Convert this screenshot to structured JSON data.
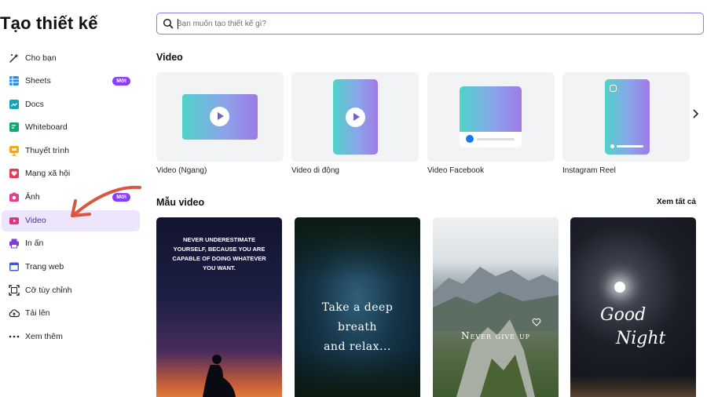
{
  "sidebar": {
    "title": "Tạo thiết kế",
    "items": [
      {
        "label": "Cho bạn",
        "icon": "sparkle-icon"
      },
      {
        "label": "Sheets",
        "icon": "sheets-icon",
        "badge": "Mới"
      },
      {
        "label": "Docs",
        "icon": "docs-icon"
      },
      {
        "label": "Whiteboard",
        "icon": "whiteboard-icon"
      },
      {
        "label": "Thuyết trình",
        "icon": "presentation-icon"
      },
      {
        "label": "Mạng xã hội",
        "icon": "heart-icon"
      },
      {
        "label": "Ảnh",
        "icon": "camera-icon",
        "badge": "Mới"
      },
      {
        "label": "Video",
        "icon": "video-icon",
        "active": true
      },
      {
        "label": "In ấn",
        "icon": "printer-icon"
      },
      {
        "label": "Trang web",
        "icon": "website-icon"
      },
      {
        "label": "Cỡ tùy chỉnh",
        "icon": "custom-size-icon"
      },
      {
        "label": "Tải lên",
        "icon": "cloud-upload-icon"
      },
      {
        "label": "Xem thêm",
        "icon": "more-icon"
      }
    ]
  },
  "search": {
    "placeholder": "Bạn muốn tạo thiết kế gì?"
  },
  "video_section": {
    "title": "Video",
    "cards": [
      {
        "label": "Video (Ngang)"
      },
      {
        "label": "Video di động"
      },
      {
        "label": "Video Facebook"
      },
      {
        "label": "Instagram Reel"
      }
    ]
  },
  "templates_section": {
    "title": "Mẫu video",
    "see_all": "Xem tất cả",
    "cards": [
      {
        "text": "NEVER UNDERESTIMATE YOURSELF, BECAUSE YOU ARE CAPABLE OF DOING WHATEVER YOU WANT."
      },
      {
        "line1": "Take a deep",
        "line2": "breath",
        "line3": "and relax..."
      },
      {
        "text": "Never give up"
      },
      {
        "line1": "Good",
        "line2": "Night"
      }
    ]
  },
  "colors": {
    "accent": "#8b3dff",
    "active_bg": "#ece5fb",
    "search_border": "#8b7cf0"
  }
}
